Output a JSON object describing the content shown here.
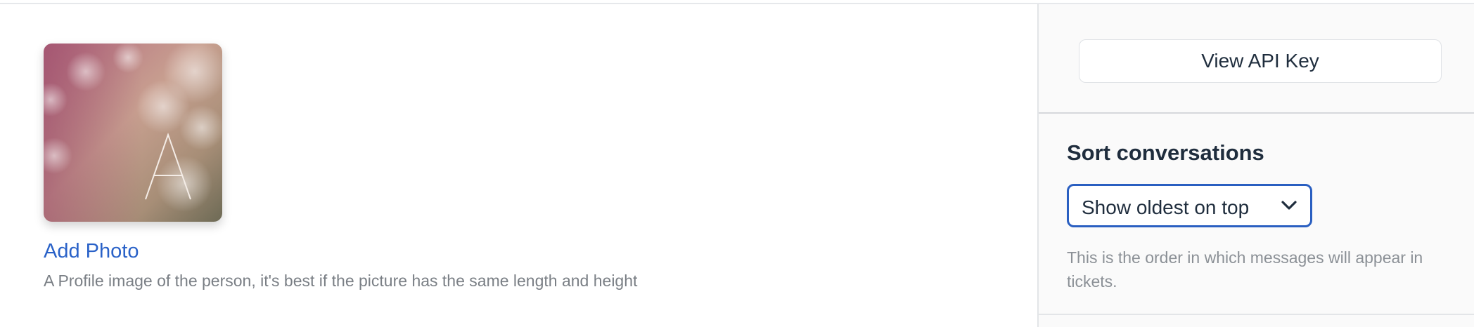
{
  "profile": {
    "avatar_letter": "A",
    "add_photo_label": "Add Photo",
    "photo_help": "A Profile image of the person, it's best if the picture has the same length and height"
  },
  "sidebar": {
    "api_key_button": "View API Key",
    "sort_title": "Sort conversations",
    "sort_select": {
      "selected": "Show oldest on top"
    },
    "sort_help": "This is the order in which messages will appear in tickets."
  },
  "colors": {
    "link": "#2a62c8",
    "select_border": "#2a5fc1",
    "text": "#1f2d3d",
    "muted": "#7a7f85"
  },
  "icons": {
    "select_caret": "chevron-down-icon"
  }
}
